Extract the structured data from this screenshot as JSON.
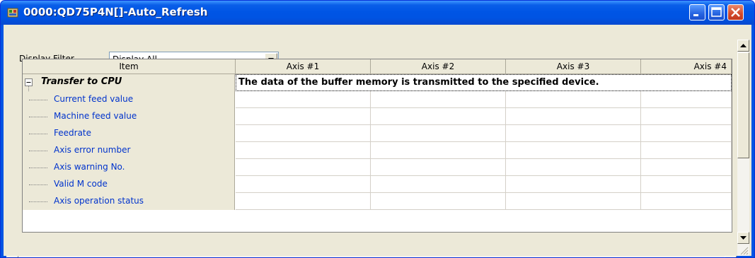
{
  "window": {
    "title": "0000:QD75P4N[]-Auto_Refresh"
  },
  "filter": {
    "label": "Display Filter",
    "value": "Display All"
  },
  "grid": {
    "columns": [
      "Item",
      "Axis #1",
      "Axis #2",
      "Axis #3",
      "Axis #4"
    ],
    "group": {
      "label": "Transfer to CPU",
      "description": "The data of the buffer memory is transmitted to the specified device."
    },
    "items": [
      "Current feed value",
      "Machine feed value",
      "Feedrate",
      "Axis error number",
      "Axis warning No.",
      "Valid M code",
      "Axis operation status"
    ]
  },
  "colors": {
    "titlebar": "#0054e3",
    "item_text": "#0033cc",
    "face": "#ece9d8"
  }
}
